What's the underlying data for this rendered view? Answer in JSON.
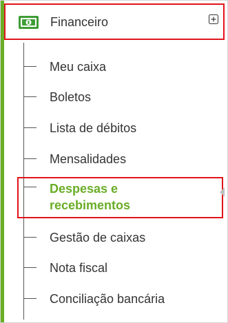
{
  "menu": {
    "header": {
      "label": "Financeiro",
      "icon": "money-bill-icon",
      "expand_icon": "plus-square-icon"
    },
    "items": [
      {
        "label": "Meu caixa"
      },
      {
        "label": "Boletos"
      },
      {
        "label": "Lista de débitos"
      },
      {
        "label": "Mensalidades"
      },
      {
        "label": "Despesas e recebimentos",
        "active": true
      },
      {
        "label": "Gestão de caixas"
      },
      {
        "label": "Nota fiscal"
      },
      {
        "label": "Conciliação bancária"
      }
    ]
  },
  "colors": {
    "accent_green": "#6aad27",
    "highlight_red": "#e1131a",
    "text": "#333333"
  }
}
